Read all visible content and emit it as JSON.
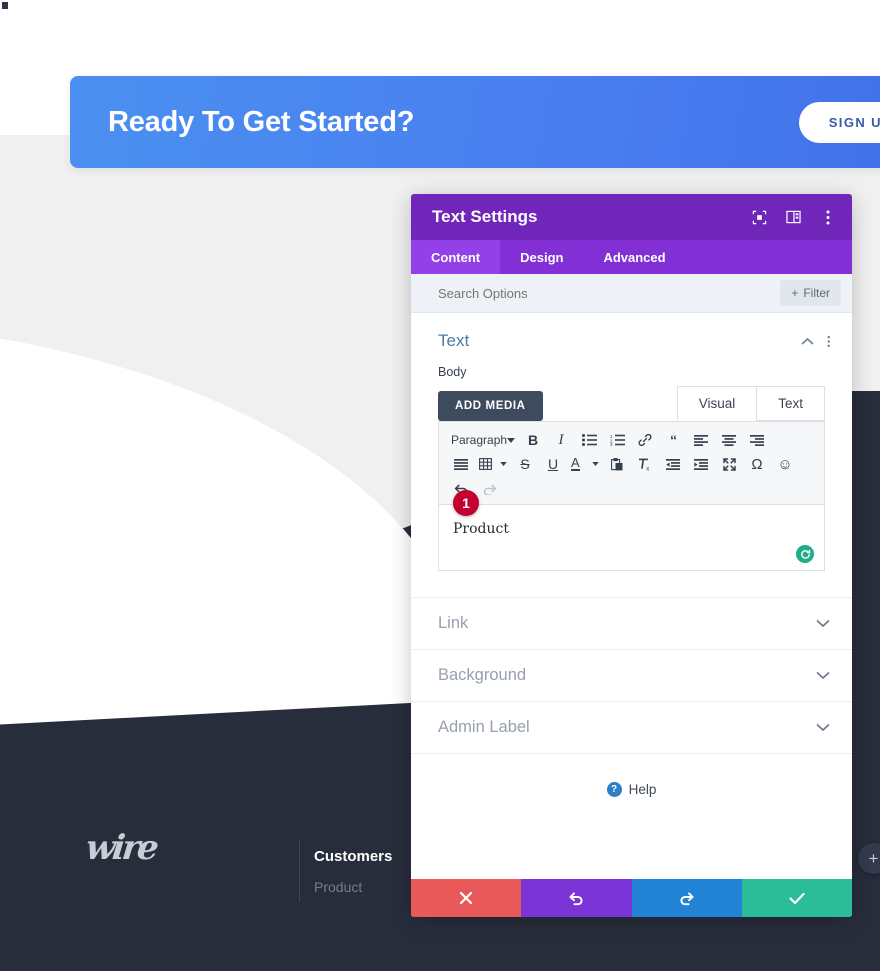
{
  "site": {
    "cta": {
      "title": "Ready To Get Started?",
      "button_label": "SIGN UP",
      "gradient_from": "#4a90f0",
      "gradient_to": "#3f6fe8"
    },
    "footer": {
      "logo_text": "wire",
      "columns": [
        {
          "heading": "Customers",
          "links": [
            "Product"
          ]
        }
      ],
      "background": "#282d3c",
      "fab_label": "+"
    }
  },
  "modal": {
    "title": "Text Settings",
    "accent": "#7026b9",
    "header_icons": [
      "focus-target-icon",
      "panel-layout-icon",
      "vertical-dots-icon"
    ],
    "tabs": [
      {
        "label": "Content",
        "active": true
      },
      {
        "label": "Design",
        "active": false
      },
      {
        "label": "Advanced",
        "active": false
      }
    ],
    "search": {
      "placeholder": "Search Options",
      "value": "",
      "filter_label": "Filter",
      "filter_plus": "+"
    },
    "section": {
      "title": "Text",
      "collapse_icon": "chevron-up-icon",
      "more_icon": "vertical-dots-icon"
    },
    "field": {
      "label": "Body",
      "add_media_label": "ADD MEDIA",
      "editor_tabs": [
        {
          "label": "Visual",
          "active": true
        },
        {
          "label": "Text",
          "active": false
        }
      ],
      "content_value": "Product",
      "step_badge": "1",
      "reset_icon": "refresh-circle-icon"
    },
    "toolbar": {
      "row1": [
        {
          "name": "paragraph-format-select",
          "label": "Paragraph",
          "glyph": "caret"
        },
        {
          "name": "bold-icon",
          "glyph": "B"
        },
        {
          "name": "italic-icon",
          "glyph": "I"
        },
        {
          "name": "bullet-list-icon",
          "glyph": "ul"
        },
        {
          "name": "numbered-list-icon",
          "glyph": "ol"
        },
        {
          "name": "link-icon",
          "glyph": "link"
        },
        {
          "name": "blockquote-icon",
          "glyph": "66"
        },
        {
          "name": "align-left-icon",
          "glyph": "al"
        },
        {
          "name": "align-center-icon",
          "glyph": "ac"
        },
        {
          "name": "align-right-icon",
          "glyph": "ar"
        }
      ],
      "row2": [
        {
          "name": "align-justify-icon",
          "glyph": "aj"
        },
        {
          "name": "table-icon",
          "glyph": "tbl"
        },
        {
          "name": "strikethrough-icon",
          "glyph": "S"
        },
        {
          "name": "underline-icon",
          "glyph": "U"
        },
        {
          "name": "text-color-icon",
          "glyph": "A"
        },
        {
          "name": "paste-as-text-icon",
          "glyph": "paste"
        },
        {
          "name": "clear-formatting-icon",
          "glyph": "Tx"
        },
        {
          "name": "outdent-icon",
          "glyph": "out"
        },
        {
          "name": "indent-icon",
          "glyph": "in"
        },
        {
          "name": "fullscreen-icon",
          "glyph": "fs"
        },
        {
          "name": "special-character-icon",
          "glyph": "Ω"
        },
        {
          "name": "emoji-icon",
          "glyph": "☺"
        }
      ],
      "row3": [
        {
          "name": "undo-icon",
          "glyph": "undo",
          "disabled": false
        },
        {
          "name": "redo-icon",
          "glyph": "redo",
          "disabled": true
        }
      ]
    },
    "accordions": [
      {
        "label": "Link",
        "icon": "chevron-down-icon"
      },
      {
        "label": "Background",
        "icon": "chevron-down-icon"
      },
      {
        "label": "Admin Label",
        "icon": "chevron-down-icon"
      }
    ],
    "help": {
      "label": "Help",
      "icon": "question-circle-icon"
    },
    "footer_actions": [
      {
        "name": "cancel-button",
        "icon": "close-x-icon",
        "color": "#e9595a"
      },
      {
        "name": "undo-button",
        "icon": "undo-arrow-icon",
        "color": "#7b35d6"
      },
      {
        "name": "redo-button",
        "icon": "redo-arrow-icon",
        "color": "#2383d4"
      },
      {
        "name": "save-button",
        "icon": "checkmark-icon",
        "color": "#2bbd97"
      }
    ]
  }
}
